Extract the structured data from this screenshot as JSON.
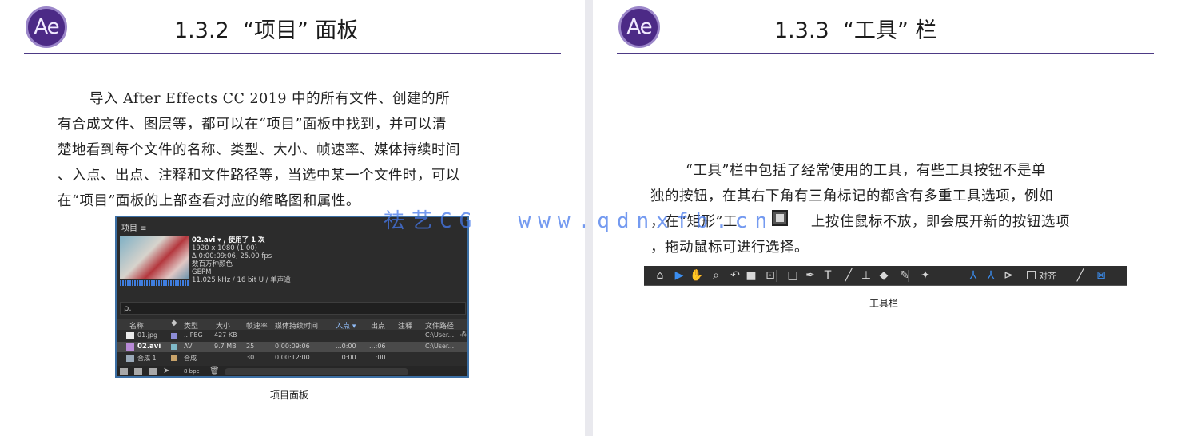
{
  "left": {
    "logo": "Ae",
    "title": "1.3.2  “项目” 面板",
    "para_lines": [
      "导入 After Effects CC 2019 中的所有文件、创建的所",
      "有合成文件、图层等，都可以在“项目”面板中找到，并可以清",
      "楚地看到每个文件的名称、类型、大小、帧速率、媒体持续时间",
      "、入点、出点、注释和文件路径等，当选中某一个文件时，可以",
      "在“项目”面板的上部查看对应的缩略图和属性。"
    ],
    "caption": "项目面板",
    "panel": {
      "header": "项目 ≡",
      "info_name": "02.avi ▾ , 使用了 1 次",
      "info_lines": [
        "1920 x 1080 (1.00)",
        "Δ 0:00:09:06, 25.00 fps",
        "数百万种颜色",
        "GEPM",
        "11.025 kHz / 16 bit U / 单声道"
      ],
      "search_icon": "ρ.",
      "columns": [
        "名称",
        "类型",
        "大小",
        "帧速率",
        "媒体持续时间",
        "入点 ▾",
        "出点",
        "注释",
        "文件路径"
      ],
      "rows": [
        {
          "name": "01.jpg",
          "type": "...PEG",
          "size": "427 KB",
          "fps": "",
          "dur": "",
          "in": "",
          "out": "",
          "path": "C:\\User..."
        },
        {
          "name": "02.avi",
          "type": "AVI",
          "size": "9.7 MB",
          "fps": "25",
          "dur": "0:00:09:06",
          "in": "...0:00",
          "out": "...:06",
          "path": "C:\\User..."
        },
        {
          "name": "合成 1",
          "type": "合成",
          "size": "",
          "fps": "30",
          "dur": "0:00:12:00",
          "in": "...0:00",
          "out": "...:00",
          "path": ""
        }
      ],
      "footer_label": "8 bpc"
    },
    "colors": {
      "row_swatch_1": "#8c8cd6",
      "row_swatch_2": "#7fb9c8",
      "row_swatch_3": "#c8a36a"
    }
  },
  "right": {
    "logo": "Ae",
    "title": "1.3.3  “工具” 栏",
    "para_lines": [
      "“工具”栏中包括了经常使用的工具，有些工具按钮不是单",
      "独的按钮，在其右下角有三角标记的都含有多重工具选项，例如",
      "，在“矩形”工",
      "上按住鼠标不放，即会展开新的按钮选项",
      "，拖动鼠标可进行选择。"
    ],
    "caption": "工具栏",
    "toolbar": {
      "icons": [
        "home-icon",
        "selection-icon",
        "hand-icon",
        "zoom-icon",
        "rotate-icon",
        "camera-icon",
        "pan-behind-icon",
        "rectangle-icon",
        "pen-icon",
        "type-icon",
        "brush-icon",
        "clone-stamp-icon",
        "eraser-icon",
        "roto-brush-icon",
        "puppet-pin-icon",
        "axis-local-icon",
        "axis-world-icon",
        "axis-view-icon",
        "snap-icon",
        "expand-icon"
      ],
      "glyphs": [
        "⌂",
        "▶",
        "✋",
        "⌕",
        "↶",
        "■",
        "⊡",
        "□",
        "✒",
        "T",
        "╱",
        "⊥",
        "◆",
        "✎",
        "✦",
        "⅄",
        "⅄",
        "⊳",
        "╱",
        "⊠"
      ],
      "snap_label": "对齐"
    }
  },
  "watermark": "祛艺CG  www.qdnxfb.cn"
}
